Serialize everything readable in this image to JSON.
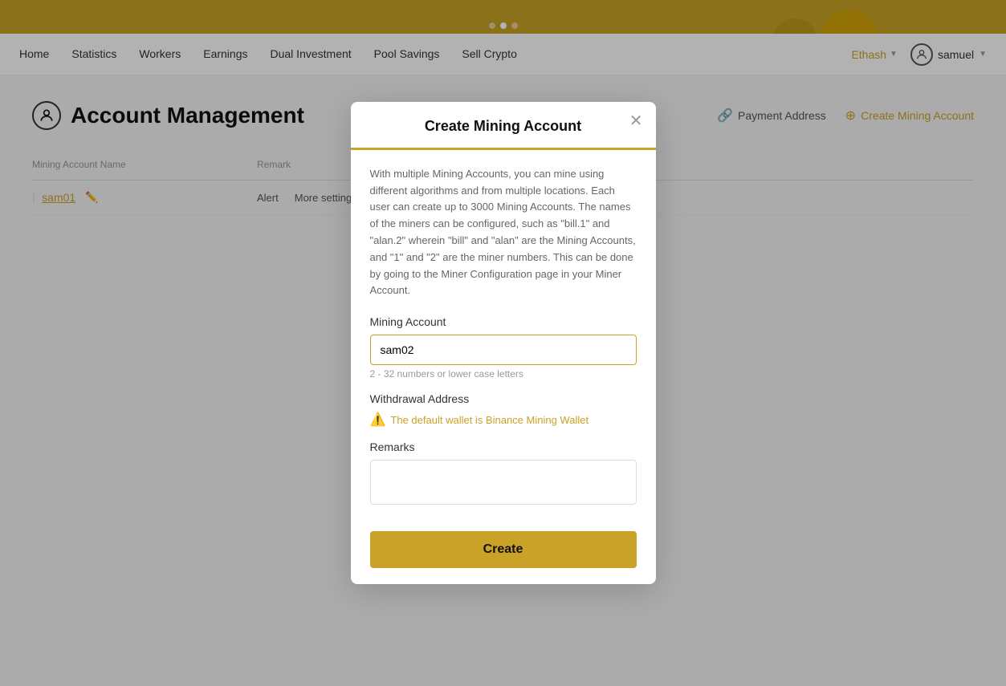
{
  "banner": {
    "dots": [
      false,
      true,
      false
    ]
  },
  "nav": {
    "links": [
      "Home",
      "Statistics",
      "Workers",
      "Earnings",
      "Dual Investment",
      "Pool Savings",
      "Sell Crypto"
    ],
    "algorithm": "Ethash",
    "username": "samuel"
  },
  "page": {
    "title": "Account Management",
    "actions": {
      "payment_address": "Payment Address",
      "create_mining_account": "Create Mining Account"
    },
    "table": {
      "columns": [
        "Mining Account Name",
        "Remark"
      ],
      "rows": [
        {
          "name": "sam01",
          "remark": "",
          "actions": [
            "Alert",
            "More settings"
          ]
        }
      ]
    }
  },
  "modal": {
    "title": "Create Mining Account",
    "info": "With multiple Mining Accounts, you can mine using different algorithms and from multiple locations. Each user can create up to 3000 Mining Accounts. The names of the miners can be configured, such as \"bill.1\" and \"alan.2\" wherein \"bill\" and \"alan\" are the Mining Accounts, and \"1\" and \"2\" are the miner numbers. This can be done by going to the Miner Configuration page in your Miner Account.",
    "mining_account_label": "Mining Account",
    "mining_account_value": "sam02",
    "mining_account_hint": "2 - 32 numbers or lower case letters",
    "withdrawal_label": "Withdrawal Address",
    "withdrawal_warning": "The default wallet is Binance Mining Wallet",
    "remarks_label": "Remarks",
    "remarks_value": "",
    "create_button": "Create"
  }
}
